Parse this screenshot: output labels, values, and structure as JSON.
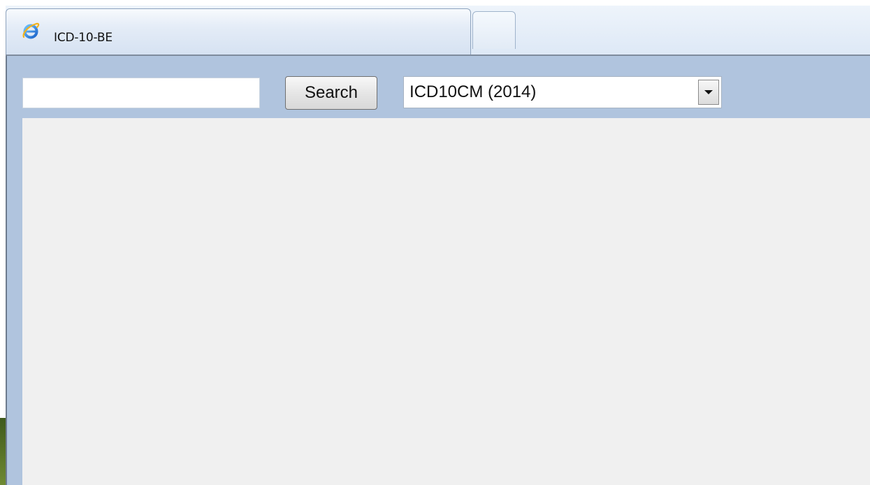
{
  "browser": {
    "tab_title": "ICD-10-BE",
    "tab_icon": "internet-explorer-icon",
    "new_tab_icon": "new-tab-icon"
  },
  "toolbar": {
    "search_value": "",
    "search_button_label": "Search",
    "dataset_selected": "ICD10CM (2014)",
    "dataset_arrow_icon": "chevron-down-icon"
  },
  "colors": {
    "frame_background": "#b0c4de",
    "content_background": "#f0f0f0",
    "tab_background": "#dde8f6"
  }
}
